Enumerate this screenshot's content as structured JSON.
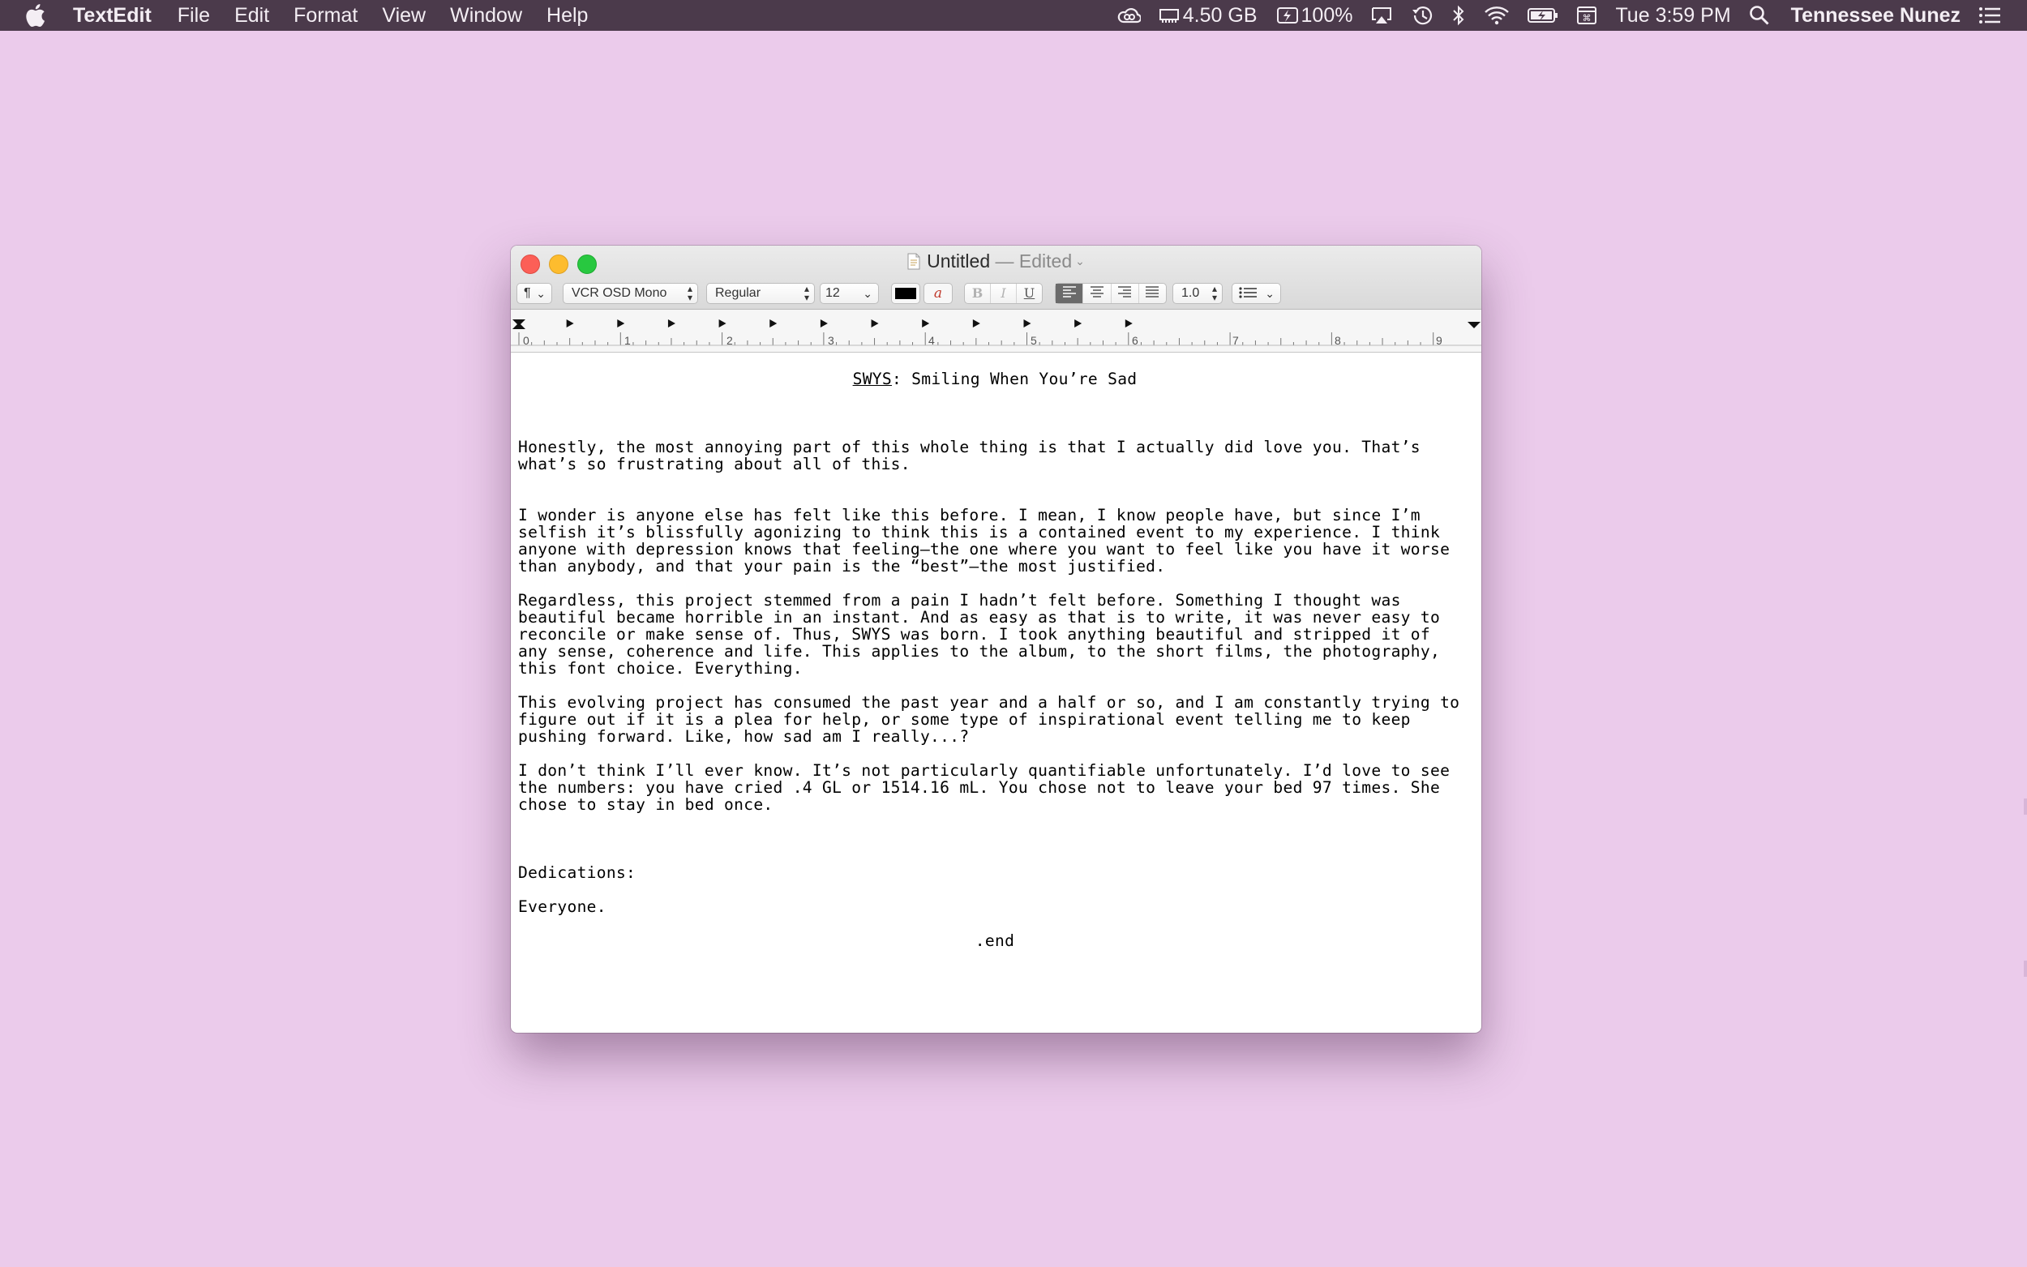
{
  "menubar": {
    "app_name": "TextEdit",
    "menus": [
      "File",
      "Edit",
      "Format",
      "View",
      "Window",
      "Help"
    ],
    "memory": "4.50 GB",
    "battery": "100%",
    "clock": "Tue 3:59 PM",
    "user": "Tennessee Nunez"
  },
  "window": {
    "title": "Untitled",
    "title_sep": " — ",
    "title_status": "Edited",
    "toolbar": {
      "paragraph_glyph": "¶",
      "font_family": "VCR OSD Mono",
      "font_style": "Regular",
      "font_size": "12",
      "bold": "B",
      "italic": "I",
      "underline": "U",
      "line_spacing": "1.0",
      "highlight_glyph": "a"
    },
    "ruler_numbers": [
      "0",
      "1",
      "2",
      "3",
      "4",
      "5",
      "6",
      "7",
      "8",
      "9"
    ]
  },
  "document": {
    "title_underlined": "SWYS",
    "title_rest": ": Smiling When You’re Sad",
    "p1": "Honestly, the most annoying part of this whole thing is that I actually did love you. That’s\nwhat’s so frustrating about all of this.",
    "p2": "I wonder is anyone else has felt like this before. I mean, I know people have, but since I’m\nselfish it’s blissfully agonizing to think this is a contained event to my experience. I think\nanyone with depression knows that feeling—the one where you want to feel like you have it worse\nthan anybody, and that your pain is the “best”—the most justified.",
    "p3": "Regardless, this project stemmed from a pain I hadn’t felt before. Something I thought was\nbeautiful became horrible in an instant. And as easy as that is to write, it was never easy to\nreconcile or make sense of. Thus, SWYS was born. I took anything beautiful and stripped it of\nany sense, coherence and life. This applies to the album, to the short films, the photography,\nthis font choice. Everything.",
    "p4": "This evolving project has consumed the past year and a half or so, and I am constantly trying to\nfigure out if it is a plea for help, or some type of inspirational event telling me to keep\npushing forward. Like, how sad am I really...?",
    "p5": "I don’t think I’ll ever know. It’s not particularly quantifiable unfortunately. I’d love to see\nthe numbers: you have cried .4 GL or 1514.16 mL. You chose not to leave your bed 97 times. She\nchose to stay in bed once.",
    "dedications_label": "Dedications:",
    "dedications_text": "Everyone.",
    "end": ".end"
  }
}
